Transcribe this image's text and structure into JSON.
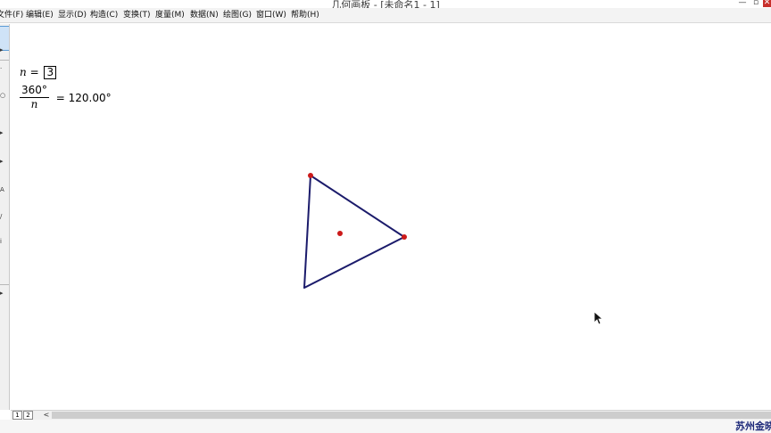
{
  "window": {
    "title": "几何画板 - [未命名1 - 1]",
    "min_glyph": "—",
    "max_glyph": "▫",
    "close_glyph": "✕"
  },
  "menu": [
    {
      "label": "文件(F)"
    },
    {
      "label": "编辑(E)"
    },
    {
      "label": "显示(D)"
    },
    {
      "label": "构造(C)"
    },
    {
      "label": "变换(T)"
    },
    {
      "label": "度量(M)"
    },
    {
      "label": "数据(N)"
    },
    {
      "label": "绘图(G)"
    },
    {
      "label": "窗口(W)"
    },
    {
      "label": "帮助(H)"
    }
  ],
  "toolbox": {
    "tools": [
      {
        "icon": "arrow-tool-icon",
        "glyph": "▸"
      },
      {
        "icon": "point-tool-icon",
        "glyph": "·"
      },
      {
        "icon": "compass-tool-icon",
        "glyph": "○"
      },
      {
        "icon": "straightedge-tool-icon",
        "glyph": "▸"
      },
      {
        "icon": "polygon-tool-icon",
        "glyph": "▸"
      },
      {
        "icon": "text-tool-icon",
        "glyph": "A"
      },
      {
        "icon": "marker-tool-icon",
        "glyph": "/"
      },
      {
        "icon": "info-tool-icon",
        "glyph": "i"
      },
      {
        "icon": "custom-tool-icon",
        "glyph": "▸"
      }
    ]
  },
  "canvas": {
    "parameter": {
      "variable": "n",
      "equals": "=",
      "value": "3"
    },
    "calculation": {
      "numerator": "360°",
      "denominator": "n",
      "equals": "= 120.00°"
    }
  },
  "colors": {
    "polygon_stroke": "#1b1b6b",
    "point_fill": "#cc1a1a",
    "watermark": "#1e2a7a"
  },
  "pages": {
    "tabs": [
      "1",
      "2"
    ],
    "scroll_left_glyph": "<"
  },
  "watermark": "苏州金晓"
}
